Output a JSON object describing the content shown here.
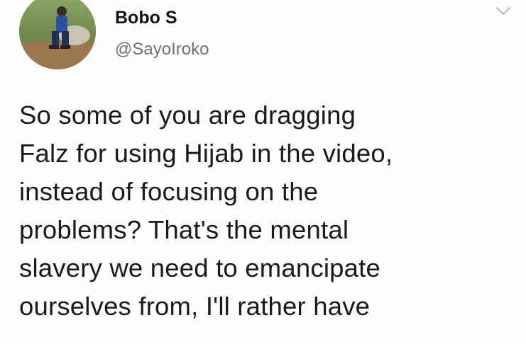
{
  "tweet": {
    "display_name": "Bobo S",
    "handle": "@SayoIroko",
    "text_lines": [
      "So some of you are dragging",
      "Falz for using Hijab in the video,",
      "instead of focusing on the",
      "problems? That's the mental",
      "slavery we need to emancipate",
      "ourselves from, I'll rather have"
    ]
  },
  "icons": {
    "caret": "chevron-down-icon"
  },
  "colors": {
    "background": "#fdfdfd",
    "text": "#1a1a1a",
    "handle": "#6f7277",
    "caret": "#b7bcc1"
  }
}
